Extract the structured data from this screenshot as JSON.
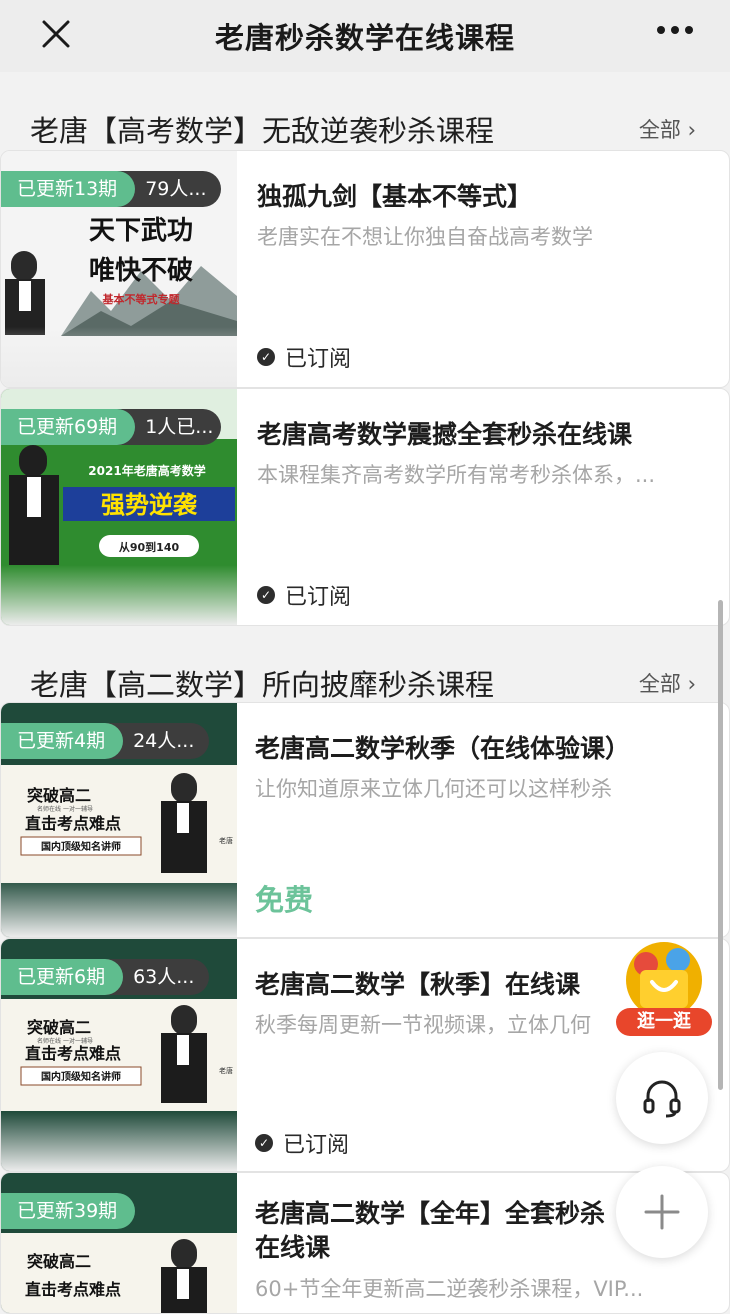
{
  "header": {
    "title": "老唐秒杀数学在线课程"
  },
  "sections": [
    {
      "title": "老唐【高考数学】无敌逆袭秒杀课程",
      "all_label": "全部 ›"
    },
    {
      "title": "老唐【高二数学】所向披靡秒杀课程",
      "all_label": "全部 ›"
    }
  ],
  "courses": [
    {
      "updated": "已更新13期",
      "subscribers": "79人...",
      "title": "独孤九剑【基本不等式】",
      "desc": "老唐实在不想让你独自奋战高考数学",
      "status": "已订阅",
      "poster": {
        "line1": "天下武功",
        "line2": "唯快不破",
        "line3": "基本不等式专题"
      }
    },
    {
      "updated": "已更新69期",
      "subscribers": "1人已...",
      "title": "老唐高考数学震撼全套秒杀在线课",
      "desc": "本课程集齐高考数学所有常考秒杀体系，...",
      "status": "已订阅",
      "poster": {
        "line1": "2021年老唐高考数学",
        "line2": "强势逆袭",
        "line3": "从90到140"
      }
    },
    {
      "updated": "已更新4期",
      "subscribers": "24人...",
      "title": "老唐高二数学秋季（在线体验课）",
      "desc": "让你知道原来立体几何还可以这样秒杀",
      "price": "免费",
      "poster": {
        "line1": "突破高二",
        "line2": "直击考点难点",
        "line3": "国内顶级知名讲师",
        "tag": "名师在线 一对一辅导",
        "side": "老唐"
      }
    },
    {
      "updated": "已更新6期",
      "subscribers": "63人...",
      "title": "老唐高二数学【秋季】在线课",
      "desc": "秋季每周更新一节视频课，立体几何",
      "status": "已订阅",
      "poster": {
        "line1": "突破高二",
        "line2": "直击考点难点",
        "line3": "国内顶级知名讲师",
        "tag": "名师在线 一对一辅导",
        "side": "老唐"
      }
    },
    {
      "updated": "已更新39期",
      "title": "老唐高二数学【全年】全套秒杀在线课",
      "desc": "60+节全年更新高二逆袭秒杀课程，VIP...",
      "poster": {
        "line1": "突破高二",
        "line2": "直击考点难点"
      }
    }
  ],
  "floating": {
    "shop_label": "逛一逛"
  },
  "colors": {
    "accent_green": "#5fbd8e",
    "free_green": "#6cc39a",
    "badge_dark": "#3d3d3d",
    "shop_red": "#e8462b"
  }
}
